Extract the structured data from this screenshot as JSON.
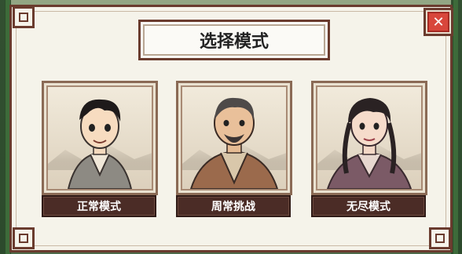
{
  "dialog": {
    "title": "选择模式",
    "close_label": "✕"
  },
  "modes": [
    {
      "label": "正常模式",
      "portrait": "young-boy-portrait"
    },
    {
      "label": "周常挑战",
      "portrait": "bearded-man-portrait"
    },
    {
      "label": "无尽模式",
      "portrait": "young-woman-portrait"
    }
  ],
  "colors": {
    "frame": "#6a3b2e",
    "button_bg": "#4b2c26",
    "close_red": "#d8463b",
    "panel_bg": "#f5f3ea"
  }
}
